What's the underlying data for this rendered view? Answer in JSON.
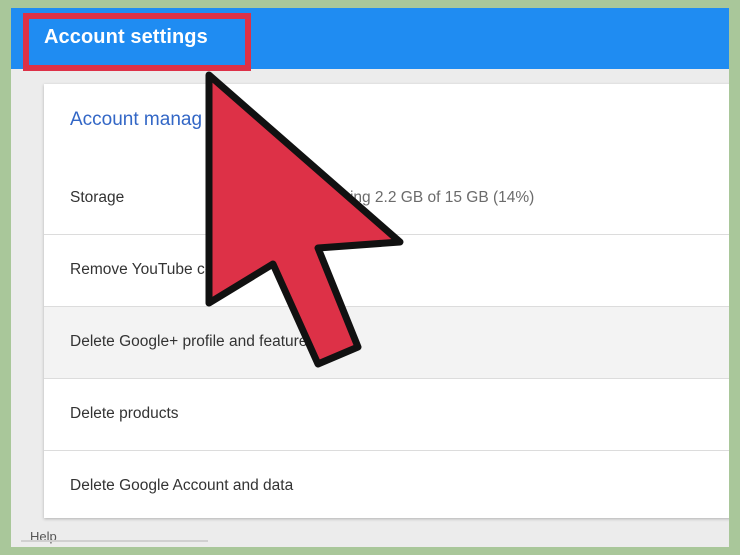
{
  "header": {
    "title": "Account settings"
  },
  "account_management": {
    "heading": "Account manag",
    "rows": [
      {
        "label": "Storage",
        "value": "Using 2.2 GB of 15 GB (14%)"
      },
      {
        "label": "Remove YouTube co"
      },
      {
        "label": "Delete Google+ profile and features"
      },
      {
        "label": "Delete products"
      },
      {
        "label": "Delete Google Account and data"
      }
    ],
    "storage": {
      "used_gb": 2.2,
      "total_gb": 15,
      "percent": 14
    }
  },
  "footer": {
    "help_label": "Help"
  },
  "annotation": {
    "arrow_color": "#dd3147",
    "highlight_color": "#dd3147"
  },
  "colors": {
    "topbar": "#1f8cf2",
    "heading": "#3367c6",
    "frame": "#a9c79a"
  }
}
